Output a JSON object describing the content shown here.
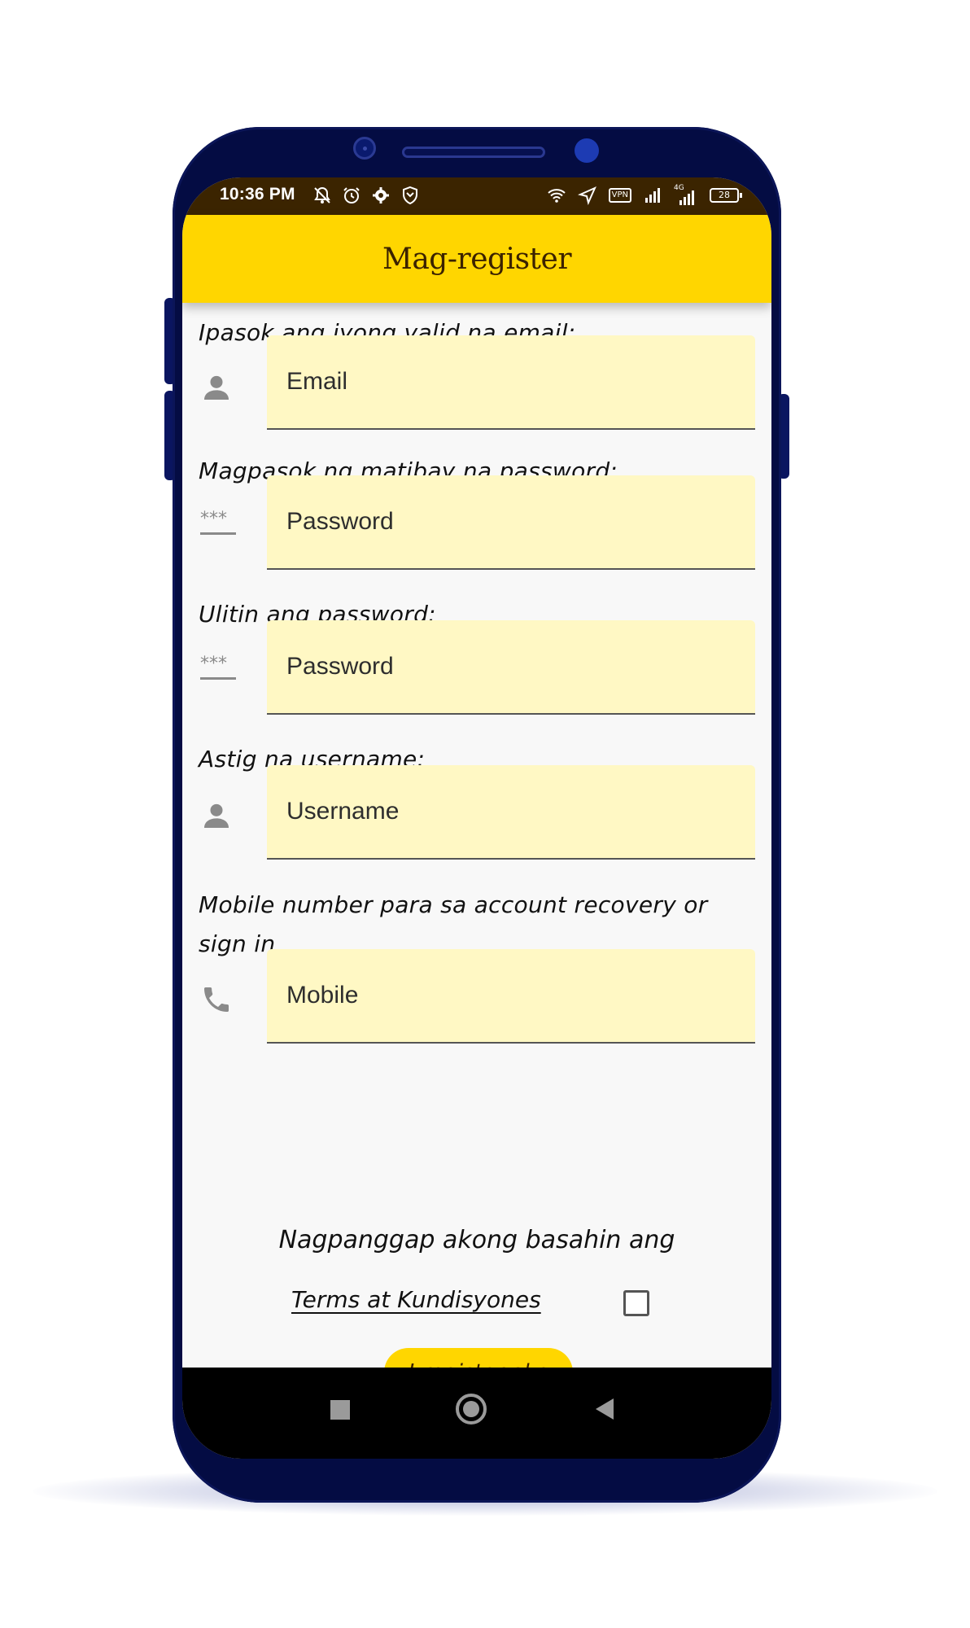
{
  "statusbar": {
    "time": "10:36 PM",
    "left_icons": [
      "bell-off-icon",
      "alarm-icon",
      "gear-icon",
      "shield-icon"
    ],
    "right_icons": [
      "wifi-icon",
      "navigation-icon",
      "vpn-icon",
      "signal-icon",
      "signal-4g-icon",
      "battery-icon"
    ],
    "vpn_label": "VPN",
    "network_label": "4G",
    "battery_level": "28"
  },
  "appbar": {
    "title": "Mag-register",
    "color": "#ffd600"
  },
  "form": {
    "email": {
      "label": "Ipasok ang iyong valid na email:",
      "placeholder": "Email",
      "icon": "person-icon"
    },
    "password": {
      "label": "Magpasok ng matibay na password:",
      "placeholder": "Password",
      "icon": "password-icon"
    },
    "confirm_password": {
      "label": "Ulitin ang password:",
      "placeholder": "Password",
      "icon": "password-icon"
    },
    "username": {
      "label": "Astig na username:",
      "placeholder": "Username",
      "icon": "person-icon"
    },
    "mobile": {
      "label": "Mobile number para sa account recovery or sign in",
      "placeholder": "Mobile",
      "icon": "phone-icon"
    }
  },
  "terms": {
    "intro": "Nagpanggap akong basahin ang",
    "link": "Terms at Kundisyones",
    "checked": false
  },
  "register_button": {
    "label": "I-register ako"
  },
  "colors": {
    "phone_frame": "#040c43",
    "input_bg": "#fff8c4",
    "statusbar_bg": "#3b2400"
  }
}
